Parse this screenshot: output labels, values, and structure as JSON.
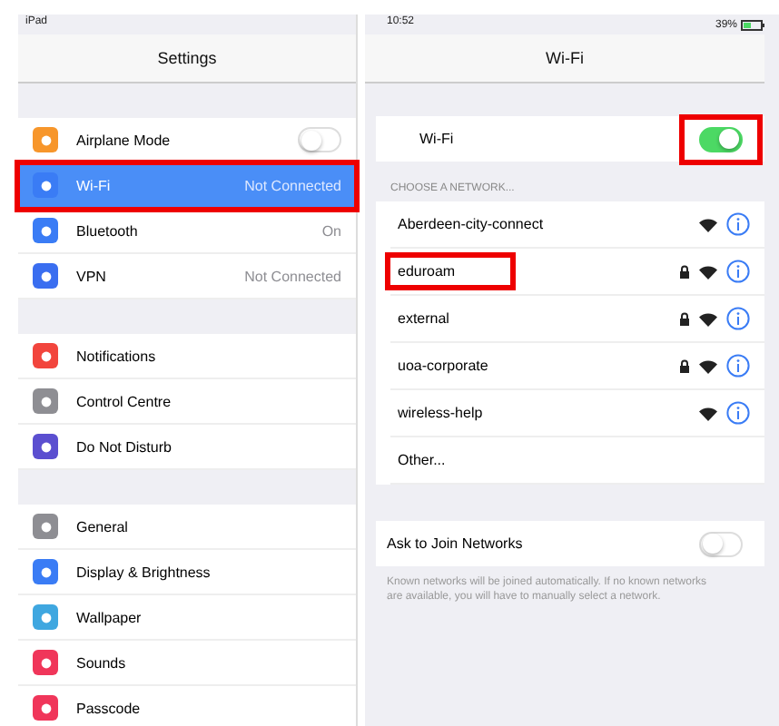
{
  "left_status": {
    "device": "iPad"
  },
  "sidebar": {
    "title": "Settings",
    "groups": [
      [
        {
          "label": "Airplane Mode",
          "kind": "toggle",
          "on": false,
          "selected": false,
          "highlighted": false,
          "color": "#f7962b"
        },
        {
          "label": "Wi-Fi",
          "kind": "value",
          "value": "Not Connected",
          "selected": true,
          "highlighted": true,
          "color": "#3a7cf5"
        },
        {
          "label": "Bluetooth",
          "kind": "value",
          "value": "On",
          "selected": false,
          "highlighted": false,
          "color": "#3a7cf5"
        },
        {
          "label": "VPN",
          "kind": "value",
          "value": "Not Connected",
          "selected": false,
          "highlighted": false,
          "color": "#3a6ef0"
        }
      ],
      [
        {
          "label": "Notifications",
          "kind": "plain",
          "selected": false,
          "highlighted": false,
          "color": "#f2453d"
        },
        {
          "label": "Control Centre",
          "kind": "plain",
          "selected": false,
          "highlighted": false,
          "color": "#8e8e93"
        },
        {
          "label": "Do Not Disturb",
          "kind": "plain",
          "selected": false,
          "highlighted": false,
          "color": "#5b4fd0"
        }
      ],
      [
        {
          "label": "General",
          "kind": "plain",
          "selected": false,
          "highlighted": false,
          "color": "#8e8e93"
        },
        {
          "label": "Display & Brightness",
          "kind": "plain",
          "selected": false,
          "highlighted": false,
          "color": "#3a7cf5"
        },
        {
          "label": "Wallpaper",
          "kind": "plain",
          "selected": false,
          "highlighted": false,
          "color": "#3fa7e0"
        },
        {
          "label": "Sounds",
          "kind": "plain",
          "selected": false,
          "highlighted": false,
          "color": "#f0365a"
        },
        {
          "label": "Passcode",
          "kind": "plain",
          "selected": false,
          "highlighted": false,
          "color": "#f0365a"
        }
      ]
    ]
  },
  "status_bar": {
    "time": "10:52",
    "battery": "39%"
  },
  "detail": {
    "title": "Wi-Fi",
    "wifi_row": {
      "label": "Wi-Fi",
      "on": true,
      "highlighted": true
    },
    "section_header": "CHOOSE A NETWORK...",
    "networks": [
      {
        "name": "Aberdeen-city-connect",
        "locked": false,
        "highlighted": false
      },
      {
        "name": "eduroam",
        "locked": true,
        "highlighted": true
      },
      {
        "name": "external",
        "locked": true,
        "highlighted": false
      },
      {
        "name": "uoa-corporate",
        "locked": true,
        "highlighted": false
      },
      {
        "name": "wireless-help",
        "locked": false,
        "highlighted": false
      }
    ],
    "other": "Other...",
    "ask_row": {
      "label": "Ask to Join Networks",
      "on": false
    },
    "footnote": "Known networks will be joined automatically. If no known networks are available, you will have to manually select a network."
  }
}
